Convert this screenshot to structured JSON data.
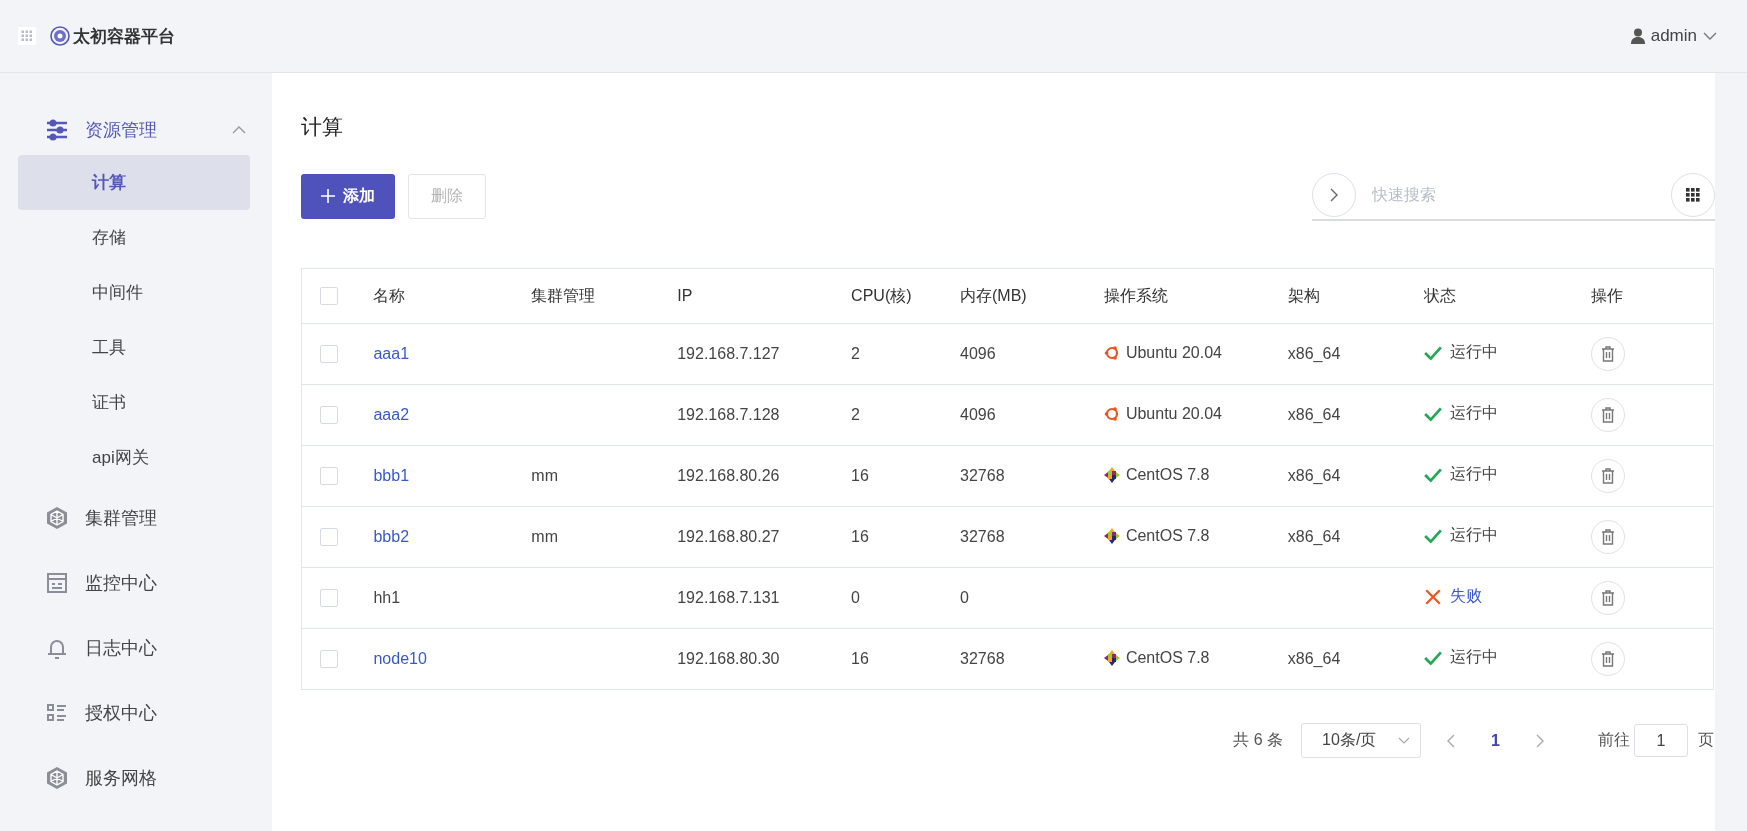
{
  "header": {
    "app_title": "太初容器平台",
    "user": "admin"
  },
  "sidebar": {
    "items": [
      {
        "label": "资源管理",
        "expanded": true,
        "children": [
          {
            "label": "计算",
            "selected": true
          },
          {
            "label": "存储",
            "selected": false
          },
          {
            "label": "中间件",
            "selected": false
          },
          {
            "label": "工具",
            "selected": false
          },
          {
            "label": "证书",
            "selected": false
          },
          {
            "label": "api网关",
            "selected": false
          }
        ]
      },
      {
        "label": "集群管理",
        "expanded": false
      },
      {
        "label": "监控中心",
        "expanded": false
      },
      {
        "label": "日志中心",
        "expanded": false
      },
      {
        "label": "授权中心",
        "expanded": false
      },
      {
        "label": "服务网格",
        "expanded": false
      }
    ]
  },
  "page_title": "计算",
  "toolbar": {
    "add": "添加",
    "delete": "删除",
    "delete_disabled": true,
    "search": {
      "placeholder": "快速搜索"
    }
  },
  "table": {
    "select_all_checked": false,
    "columns": [
      "名称",
      "集群管理",
      "IP",
      "CPU(核)",
      "内存(MB)",
      "操作系统",
      "架构",
      "状态",
      "操作"
    ],
    "rows": [
      {
        "checked": false,
        "name": "aaa1",
        "linked": true,
        "ip": "192.168.7.127",
        "cpu": "2",
        "memory": "4096",
        "os": {
          "kind": "ubuntu",
          "name": "Ubuntu 20.04"
        },
        "arch": "x86_64",
        "status": {
          "kind": "running",
          "label": "运行中"
        }
      },
      {
        "checked": false,
        "name": "aaa2",
        "linked": true,
        "ip": "192.168.7.128",
        "cpu": "2",
        "memory": "4096",
        "os": {
          "kind": "ubuntu",
          "name": "Ubuntu 20.04"
        },
        "arch": "x86_64",
        "status": {
          "kind": "running",
          "label": "运行中"
        }
      },
      {
        "checked": false,
        "name": "bbb1",
        "linked": true,
        "cluster": "mm",
        "ip": "192.168.80.26",
        "cpu": "16",
        "memory": "32768",
        "os": {
          "kind": "centos",
          "name": "CentOS 7.8"
        },
        "arch": "x86_64",
        "status": {
          "kind": "running",
          "label": "运行中"
        }
      },
      {
        "checked": false,
        "name": "bbb2",
        "linked": true,
        "cluster": "mm",
        "ip": "192.168.80.27",
        "cpu": "16",
        "memory": "32768",
        "os": {
          "kind": "centos",
          "name": "CentOS 7.8"
        },
        "arch": "x86_64",
        "status": {
          "kind": "running",
          "label": "运行中"
        }
      },
      {
        "checked": false,
        "name": "hh1",
        "linked": false,
        "ip": "192.168.7.131",
        "cpu": "0",
        "memory": "0",
        "status": {
          "kind": "failed",
          "label": "失败"
        }
      },
      {
        "checked": false,
        "name": "node10",
        "linked": true,
        "ip": "192.168.80.30",
        "cpu": "16",
        "memory": "32768",
        "os": {
          "kind": "centos",
          "name": "CentOS 7.8"
        },
        "arch": "x86_64",
        "status": {
          "kind": "running",
          "label": "运行中"
        }
      }
    ]
  },
  "pagination": {
    "total": "共 6 条",
    "page_size": "10条/页",
    "pages": [
      {
        "label": "1",
        "selected": true
      }
    ],
    "goto_label": "前往",
    "goto_value": "1",
    "goto_suffix": "页"
  }
}
